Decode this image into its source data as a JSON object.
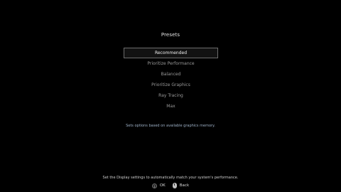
{
  "title": "Presets",
  "menu": {
    "items": [
      {
        "label": "Recommended",
        "selected": true
      },
      {
        "label": "Prioritize Performance",
        "selected": false
      },
      {
        "label": "Balanced",
        "selected": false
      },
      {
        "label": "Prioritize Graphics",
        "selected": false
      },
      {
        "label": "Ray Tracing",
        "selected": false
      },
      {
        "label": "Max",
        "selected": false
      }
    ]
  },
  "description": "Sets options based on available graphics memory.",
  "footer": {
    "hint": "Set the Display settings to automatically match your system's performance.",
    "ok": {
      "icon_label": "I",
      "label": "OK"
    },
    "back": {
      "label": "Back"
    }
  }
}
